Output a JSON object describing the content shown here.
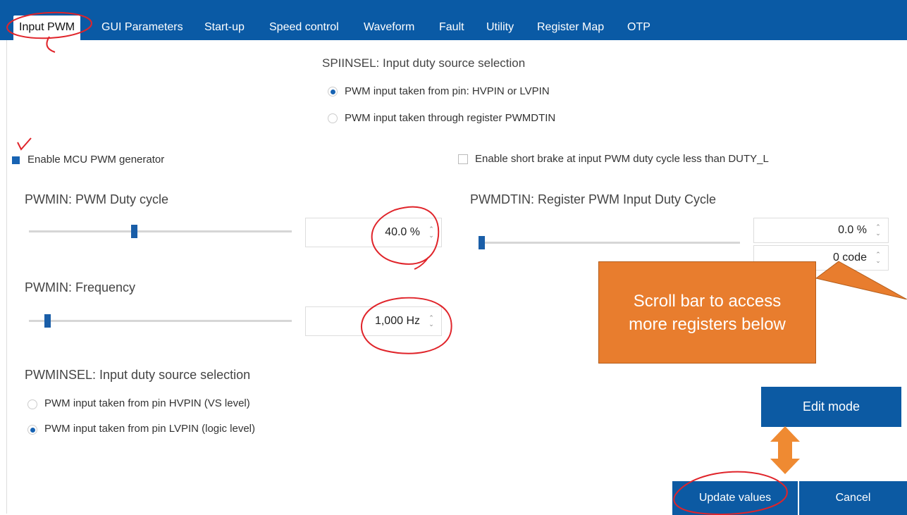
{
  "tabs": [
    {
      "label": "Input PWM",
      "active": true
    },
    {
      "label": "GUI Parameters"
    },
    {
      "label": "Start-up"
    },
    {
      "label": "Speed control"
    },
    {
      "label": "Waveform"
    },
    {
      "label": "Fault"
    },
    {
      "label": "Utility"
    },
    {
      "label": "Register Map"
    },
    {
      "label": "OTP"
    }
  ],
  "spiinsel": {
    "title": "SPIINSEL: Input duty source selection",
    "options": [
      {
        "label": "PWM input taken from pin: HVPIN or LVPIN",
        "selected": true
      },
      {
        "label": "PWM input taken through register PWMDTIN",
        "selected": false
      }
    ]
  },
  "enable_mcu": {
    "label": "Enable MCU PWM generator",
    "checked": true
  },
  "enable_brake": {
    "label": "Enable short brake at input PWM duty cycle less than DUTY_L",
    "checked": false
  },
  "pwmin_duty": {
    "title": "PWMIN: PWM Duty cycle",
    "value": "40.0 %",
    "level": 0.4
  },
  "pwmin_freq": {
    "title": "PWMIN: Frequency",
    "value": "1,000 Hz",
    "level": 0.07
  },
  "pwmdtin": {
    "title": "PWMDTIN: Register PWM Input Duty Cycle",
    "value_percent": "0.0 %",
    "value_code": "0 code",
    "level": 0.0
  },
  "pwminsel": {
    "title": "PWMINSEL: Input duty source selection",
    "options": [
      {
        "label": "PWM input taken from pin HVPIN (VS level)",
        "selected": false
      },
      {
        "label": "PWM input taken from pin LVPIN (logic level)",
        "selected": true
      }
    ]
  },
  "buttons": {
    "edit_mode": "Edit mode",
    "update_values": "Update values",
    "cancel": "Cancel"
  },
  "callout": {
    "text": "Scroll bar to access more registers below"
  },
  "colors": {
    "accent": "#0a5aa5",
    "annotation_red": "#e0242a",
    "callout_orange": "#e87d2e"
  }
}
